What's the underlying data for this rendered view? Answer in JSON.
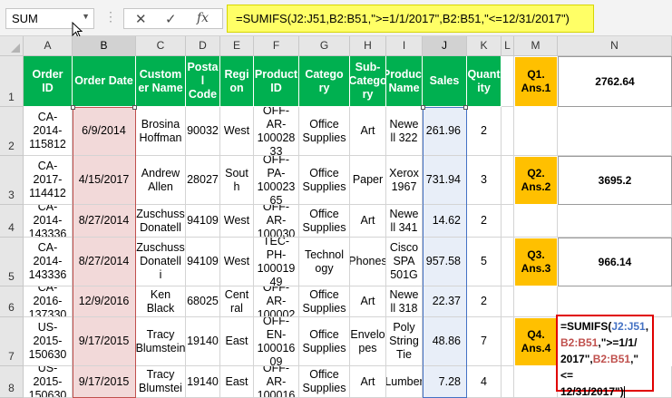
{
  "formula_bar": {
    "name_box": "SUM",
    "cancel_icon": "✕",
    "enter_icon": "✓",
    "fx_label": "fx",
    "formula": "=SUMIFS(J2:J51,B2:B51,\">=1/1/2017\",B2:B51,\"<=12/31/2017\")"
  },
  "columns": [
    "A",
    "B",
    "C",
    "D",
    "E",
    "F",
    "G",
    "H",
    "I",
    "J",
    "K",
    "L",
    "M",
    "N"
  ],
  "rows": [
    "1",
    "2",
    "3",
    "4",
    "5",
    "6",
    "7",
    "8"
  ],
  "headers": {
    "order_id": "Order\nID",
    "order_date": "Order Date",
    "customer_name": "Custom\ner Name",
    "postal_code": "Posta\nl\nCode",
    "region": "Regi\non",
    "product_id": "Product\nID",
    "category": "Catego\nry",
    "sub_category": "Sub-\nCatego\nry",
    "product_name": "Product\nName",
    "sales": "Sales",
    "quantity": "Quant\nity"
  },
  "data_rows": [
    {
      "order_id": "CA-2014-\n115812",
      "order_date": "6/9/2014",
      "customer": "Brosina\nHoffman",
      "postal": "90032",
      "region": "West",
      "product_id": "OFF-AR-\n100028\n33",
      "category": "Office\nSupplies",
      "sub_category": "Art",
      "product_name": "Newe\nll 322",
      "sales": "261.96",
      "quantity": "2"
    },
    {
      "order_id": "CA-2017-\n114412",
      "order_date": "4/15/2017",
      "customer": "Andrew\nAllen",
      "postal": "28027",
      "region": "Sout\nh",
      "product_id": "OFF-PA-\n100023\n65",
      "category": "Office\nSupplies",
      "sub_category": "Paper",
      "product_name": "Xerox\n1967",
      "sales": "731.94",
      "quantity": "3"
    },
    {
      "order_id": "CA-2014-\n143336",
      "order_date": "8/27/2014",
      "customer": "Zuschuss\nDonatell",
      "postal": "94109",
      "region": "West",
      "product_id": "OFF-AR-\n100030",
      "category": "Office\nSupplies",
      "sub_category": "Art",
      "product_name": "Newe\nll 341",
      "sales": "14.62",
      "quantity": "2"
    },
    {
      "order_id": "CA-2014-\n143336",
      "order_date": "8/27/2014",
      "customer": "Zuschuss\nDonatell\ni",
      "postal": "94109",
      "region": "West",
      "product_id": "TEC-PH-\n100019\n49",
      "category": "Technol\nogy",
      "sub_category": "Phones",
      "product_name": "Cisco\nSPA\n501G",
      "sales": "957.58",
      "quantity": "5"
    },
    {
      "order_id": "CA-2016-\n137330",
      "order_date": "12/9/2016",
      "customer": "Ken\nBlack",
      "postal": "68025",
      "region": "Cent\nral",
      "product_id": "OFF-AR-\n100002",
      "category": "Office\nSupplies",
      "sub_category": "Art",
      "product_name": "Newe\nll 318",
      "sales": "22.37",
      "quantity": "2"
    },
    {
      "order_id": "US-2015-\n150630",
      "order_date": "9/17/2015",
      "customer": "Tracy\nBlumstein",
      "postal": "19140",
      "region": "East",
      "product_id": "OFF-EN-\n100016\n09",
      "category": "Office\nSupplies",
      "sub_category": "Envelo\npes",
      "product_name": "Poly\nString\nTie",
      "sales": "48.86",
      "quantity": "7"
    },
    {
      "order_id": "US-2015-\n150630",
      "order_date": "9/17/2015",
      "customer": "Tracy\nBlumstei",
      "postal": "19140",
      "region": "East",
      "product_id": "OFF-AR-\n100016",
      "category": "Office\nSupplies",
      "sub_category": "Art",
      "product_name": "Lumber",
      "sales": "7.28",
      "quantity": "4"
    }
  ],
  "answers": [
    {
      "label": "Q1.\nAns.1",
      "value": "2762.64"
    },
    {
      "label": "Q2.\nAns.2",
      "value": "3695.2"
    },
    {
      "label": "Q3.\nAns.3",
      "value": "966.14"
    },
    {
      "label": "Q4.\nAns.4"
    }
  ],
  "edit_cell": {
    "p1": "=SUMIFS(",
    "p2": "J2:J51",
    "p3": ",",
    "p4": "B2:B51",
    "p5": ",\">=1/1/",
    "p6": "2017\",",
    "p7": "B2:B51",
    "p8": ",\"<=",
    "p9": "12/31/2017\")"
  },
  "colors": {
    "header_green": "#00b050",
    "answer_orange": "#ffc000",
    "formula_bar_highlight": "#ffff66",
    "range_b_color": "#c0504d",
    "range_j_color": "#4472c4",
    "edit_border": "#e00000"
  }
}
